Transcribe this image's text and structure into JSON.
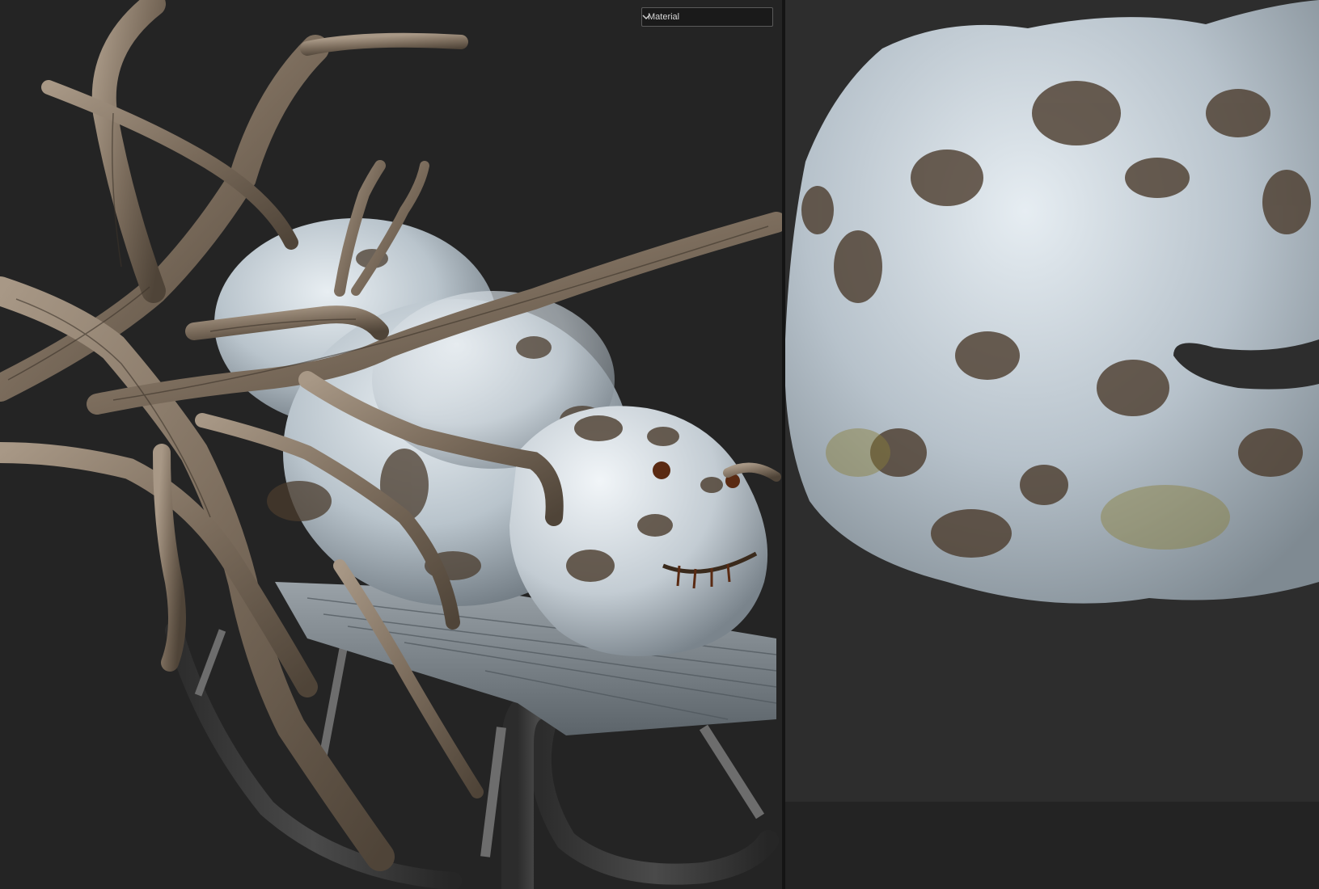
{
  "viewport_3d": {
    "shading_dropdown": {
      "selected": "Material",
      "icon": "chevron-down-icon"
    },
    "model": "snowman-on-sled"
  },
  "viewport_uv": {
    "texture": "snow-texture-uv-island"
  },
  "colors": {
    "viewport_background": "#242424",
    "uv_background": "#2d2d2d",
    "dropdown_background": "#1a1a1a",
    "dropdown_border": "#5a5a5a"
  }
}
